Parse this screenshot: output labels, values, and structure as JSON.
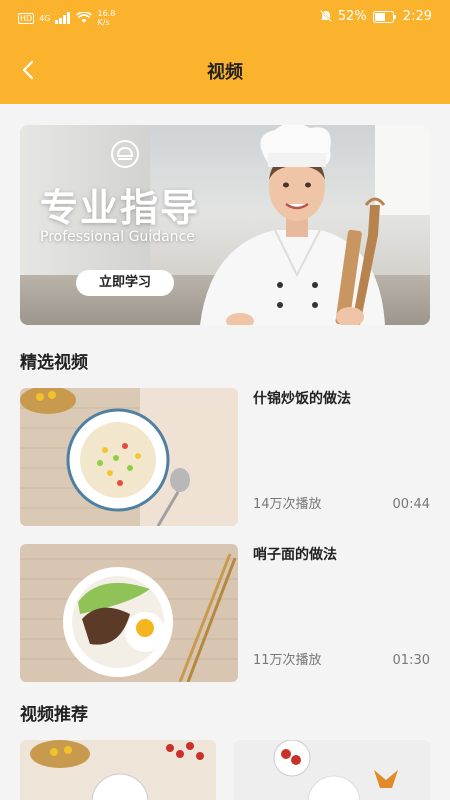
{
  "status": {
    "network_label": "HD",
    "signal_label": "4G",
    "speed_value": "16.8",
    "speed_unit": "K/s",
    "battery": "52%",
    "time": "2:29"
  },
  "nav": {
    "title": "视频"
  },
  "banner": {
    "title": "专业指导",
    "subtitle": "Professional Guidance",
    "button": "立即学习"
  },
  "featured": {
    "heading": "精选视频",
    "items": [
      {
        "title": "什锦炒饭的做法",
        "plays": "14万次播放",
        "duration": "00:44"
      },
      {
        "title": "哨子面的做法",
        "plays": "11万次播放",
        "duration": "01:30"
      }
    ]
  },
  "recommend": {
    "heading": "视频推荐"
  },
  "colors": {
    "accent": "#fbb22c",
    "background": "#f4f4f4"
  }
}
